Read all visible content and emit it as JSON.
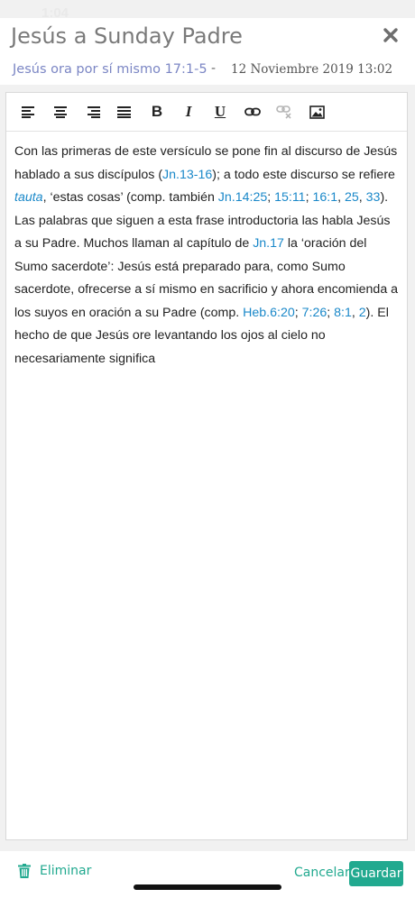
{
  "status": {
    "time": "1:04"
  },
  "header": {
    "title": "Jesús a Sunday Padre"
  },
  "subheader": {
    "passage_link": "Jesús ora por sí mismo 17:1-5",
    "separator": "-",
    "date": "12 Noviembre 2019 13:02"
  },
  "toolbar": {
    "items": [
      {
        "name": "align-left-icon"
      },
      {
        "name": "align-center-icon"
      },
      {
        "name": "align-right-icon"
      },
      {
        "name": "align-justify-icon"
      },
      {
        "name": "bold-button",
        "label": "B"
      },
      {
        "name": "italic-button",
        "label": "I"
      },
      {
        "name": "underline-button",
        "label": "U"
      },
      {
        "name": "link-icon"
      },
      {
        "name": "unlink-icon"
      },
      {
        "name": "image-icon"
      }
    ]
  },
  "content": {
    "t1": "Con las primeras de este versículo se pone fin al discurso de Jesús hablado a sus discípulos (",
    "r1": "Jn.13-16",
    "t2": "); a todo este discurso se refiere ",
    "i1": "tauta",
    "t3": ", ‘estas cosas’ (comp. también ",
    "r2": "Jn.14:25",
    "s1": "; ",
    "r3": "15:11",
    "s2": "; ",
    "r4": "16:1",
    "s3": ", ",
    "r5": "25",
    "s4": ", ",
    "r6": "33",
    "t4": "). Las palabras que siguen a esta frase introductoria las habla Jesús a su Padre. Muchos llaman al capítulo de ",
    "r7": "Jn.17",
    "t5": " la ‘oración del Sumo sacerdote’: Jesús está preparado para, como Sumo sacerdote, ofrecerse a sí mismo en sacrificio y ahora encomienda a los suyos en oración a su Padre (comp. ",
    "r8": "Heb.6:20",
    "s5": "; ",
    "r9": "7:26",
    "s6": "; ",
    "r10": "8:1",
    "s7": ", ",
    "r11": "2",
    "t6": "). El hecho de que Jesús ore levantando los ojos al cielo no necesariamente significa"
  },
  "footer": {
    "delete_label": "Eliminar",
    "cancel_label": "Cancelar",
    "save_label": "Guardar"
  },
  "colors": {
    "accent": "#21a98f",
    "link": "#1a88c9",
    "passage_link": "#7b86c4",
    "title": "#7a7a7a"
  }
}
